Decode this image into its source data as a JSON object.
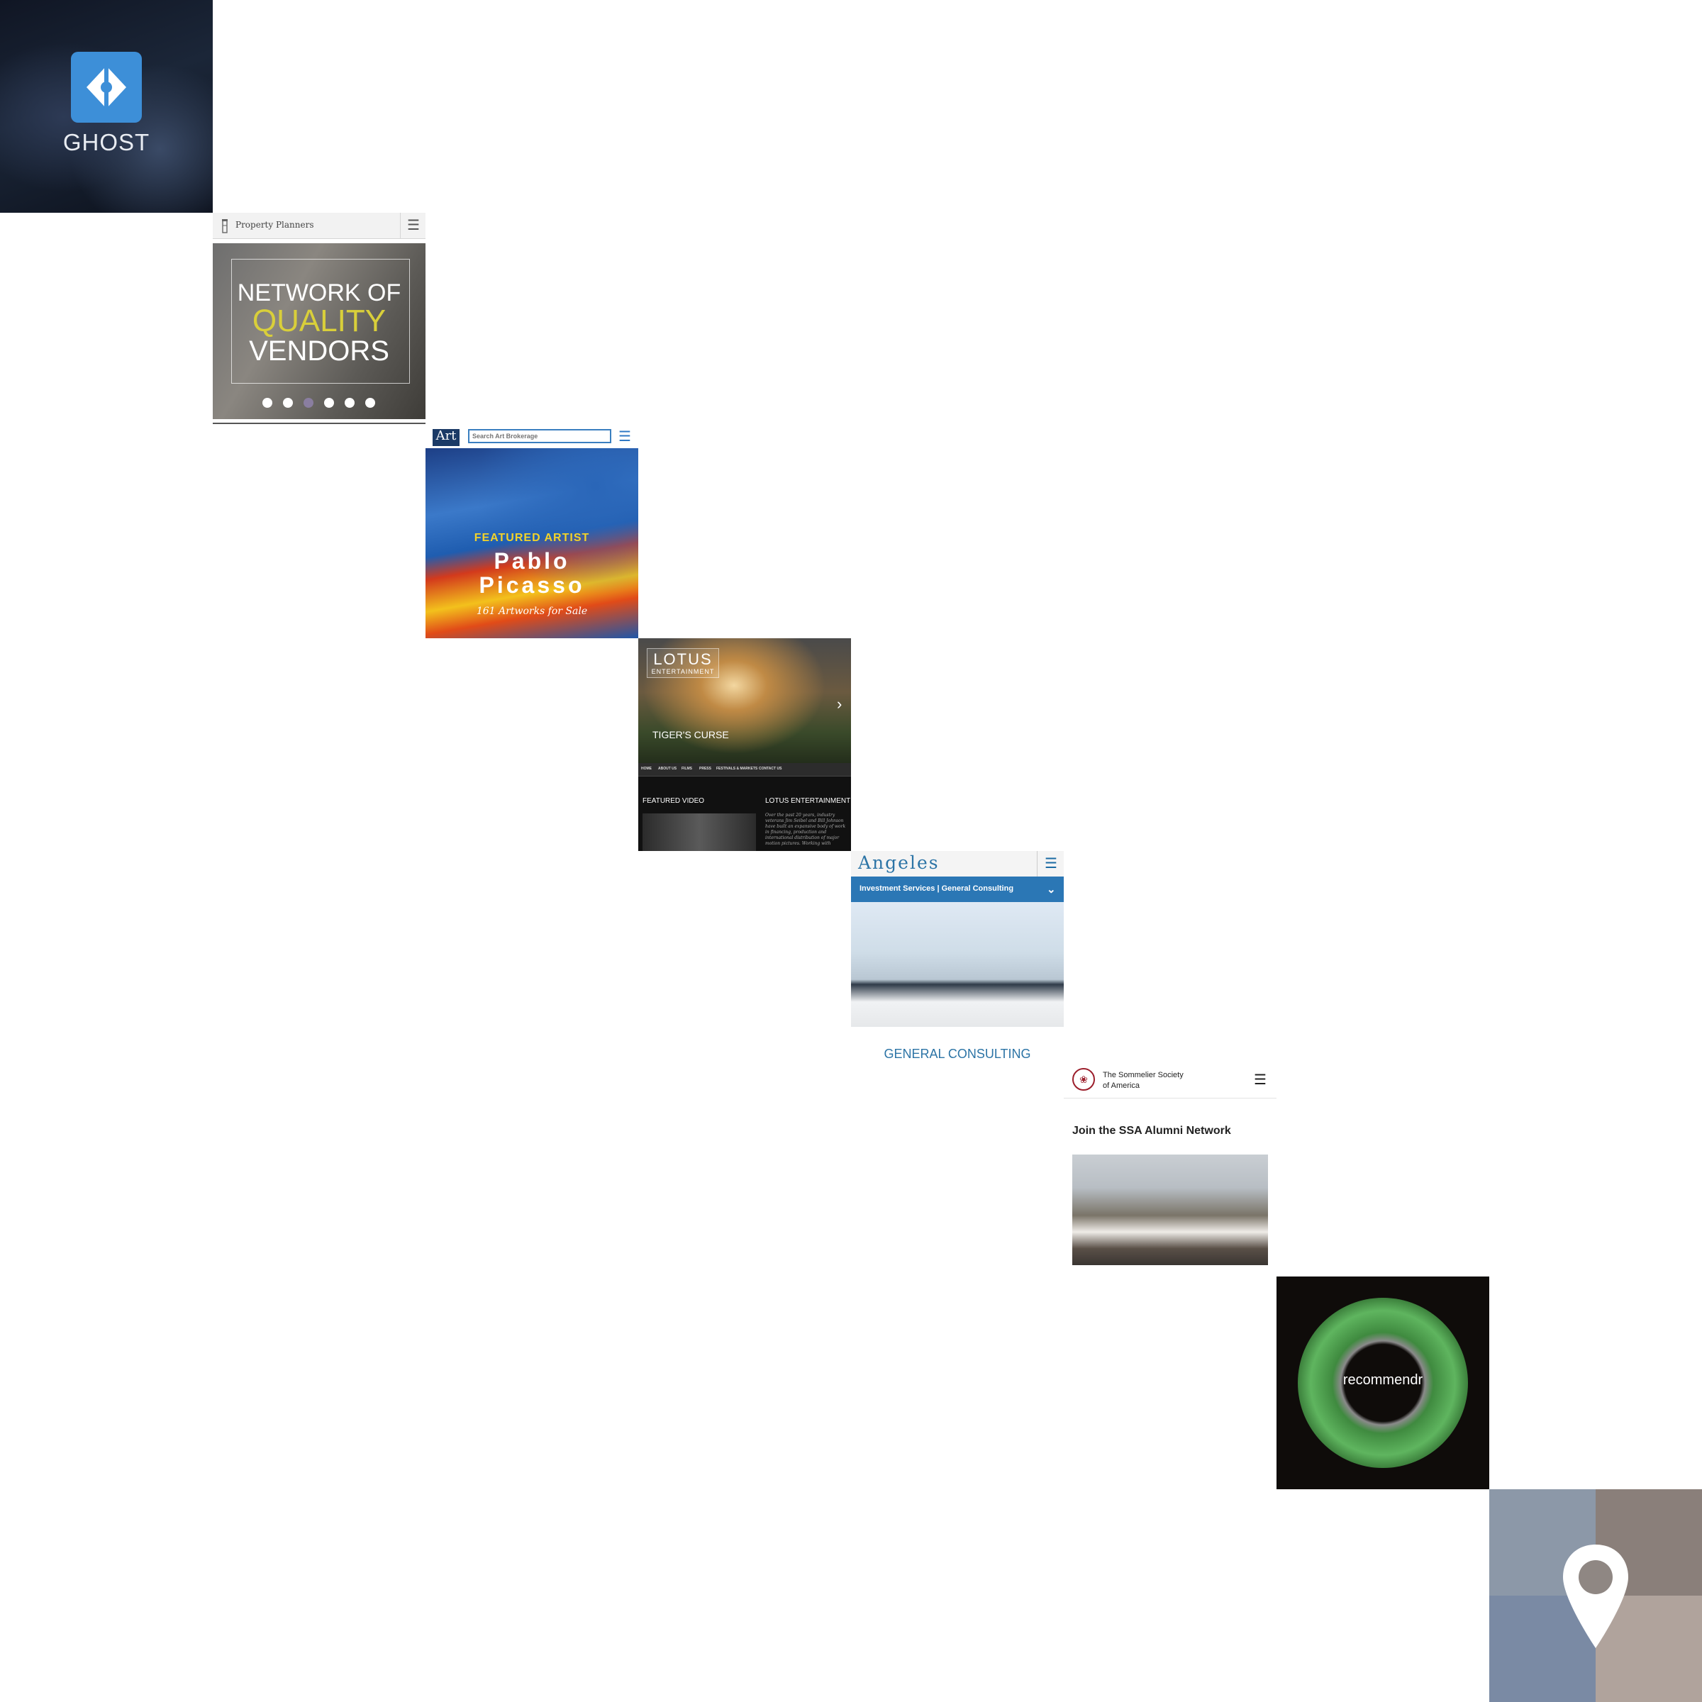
{
  "ghost": {
    "label": "GHOST",
    "accent": "#3d8fd8"
  },
  "property_planners": {
    "title": "Property Planners",
    "headline": [
      "NETWORK OF",
      "QUALITY",
      "VENDORS"
    ],
    "highlight_color": "#d9cf3a",
    "slide_count": 6,
    "active_slide": 3
  },
  "art_brokerage": {
    "logo": "Art",
    "search_placeholder": "Search Art Brokerage",
    "featured_label": "FEATURED ARTIST",
    "artist_first": "Pablo",
    "artist_last": "Picasso",
    "artworks": "161 Artworks for Sale"
  },
  "lotus": {
    "logo": "LOTUS",
    "logo_sub": "ENTERTAINMENT",
    "film_title": "TIGER'S CURSE",
    "nav": [
      "HOME",
      "ABOUT US",
      "FILMS",
      "PRESS",
      "FESTIVALS & MARKETS",
      "CONTACT US"
    ],
    "featured_video": "FEATURED VIDEO",
    "section_title": "LOTUS ENTERTAINMENT",
    "body": "Over the past 20 years, industry veterans Jim Seibel and Bill Johnson have built an expansive body of work in financing, production and international distribution of major motion pictures. Working with"
  },
  "angeles": {
    "logo": "Angeles",
    "nav_label": "Investment Services | General Consulting",
    "caption": "GENERAL CONSULTING",
    "brand_color": "#2b77b5"
  },
  "sommelier": {
    "name_line1": "The Sommelier Society",
    "name_line2": "of America",
    "heading": "Join the SSA Alumni Network",
    "seal_color": "#9c1f2c"
  },
  "recommendr": {
    "label": "recommendr"
  },
  "map": {
    "colors": [
      "#8c98a8",
      "#8a7f7a",
      "#7a8aa4",
      "#b0a39c"
    ]
  }
}
